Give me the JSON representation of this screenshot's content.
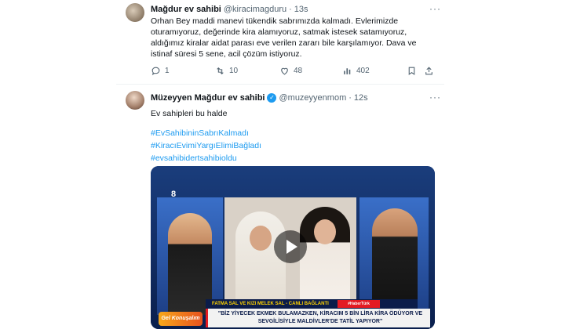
{
  "tweets": [
    {
      "author_name": "Mağdur ev sahibi",
      "handle": "@kiracimagduru",
      "separator": "·",
      "time": "13s",
      "more": "···",
      "text_lines": [
        "Orhan Bey maddi manevi tükendik sabrımızda kalmadı. Evlerimizde",
        "oturamıyoruz, değerinde kira alamıyoruz, satmak istesek satamıyoruz,",
        "aldığımız kiralar aidat parası eve verilen zararı bile karşılamıyor. Dava ve",
        "istinaf süresi 5 sene, acil çözüm istiyoruz."
      ],
      "actions": {
        "replies": "1",
        "retweets": "10",
        "likes": "48",
        "views": "402"
      }
    },
    {
      "author_name": "Müzeyyen Mağdur ev sahibi",
      "handle": "@muzeyyenmom",
      "separator": "·",
      "time": "12s",
      "more": "···",
      "text": "Ev sahipleri bu halde",
      "hashtags": [
        "#EvSahibininSabrıKalmadı",
        "#KiracıEvimiYargıElimiBağladı",
        "#evsahibidertsahibioldu"
      ],
      "media": {
        "channel_logo": "8",
        "lower_third": "FATMA SAL VE KIZI MELEK SAL - CANLI BAĞLANTI",
        "live_tag": "#HaberTürk",
        "ticker": "\"BİZ YİYECEK EKMEK BULAMAZKEN, KİRACIM 5 BİN LİRA KİRA ÖDÜYOR VE SEVGİLİSİYLE MALDİVLER'DE TATİL YAPIYOR\"",
        "show_logo": "Gel Konuşalım"
      }
    }
  ],
  "icons": {
    "reply": "reply-icon",
    "retweet": "retweet-icon",
    "like": "heart-icon",
    "views": "views-icon",
    "bookmark": "bookmark-icon",
    "share": "share-icon",
    "verified": "verified-badge-icon"
  },
  "colors": {
    "link": "#1d9bf0",
    "muted": "#536471"
  }
}
